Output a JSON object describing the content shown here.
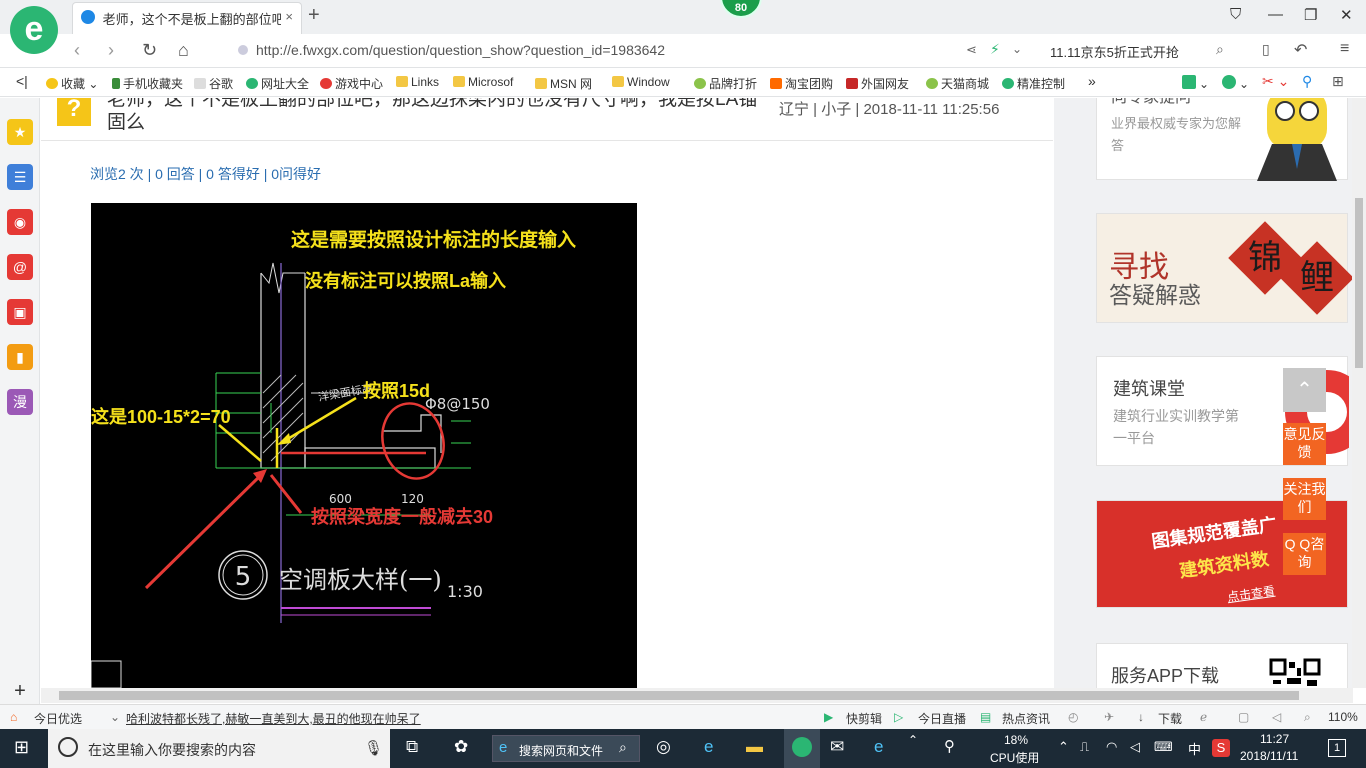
{
  "browser": {
    "tab_title": "老师，这个不是板上翻的部位吧。",
    "tab_close": "×",
    "new_tab": "+",
    "badge": "80",
    "url": "http://e.fwxgx.com/question/question_show?question_id=1983642",
    "promo": "11.11京东5折正式开抢",
    "bookmarks": [
      "收藏",
      "手机收藏夹",
      "谷歌",
      "网址大全",
      "游戏中心",
      "Links",
      "Microsof",
      "MSN 网",
      "Window",
      "品牌打折",
      "淘宝团购",
      "外国网友",
      "天猫商城",
      "精准控制"
    ],
    "bookmark_more": "»"
  },
  "question": {
    "title": "老师，这个不是板上翻的部位吧，那这边抹梁内的也没有尺寸啊，我是按LA锚固么",
    "meta": "辽宁 | 小子 | 2018-11-11 11:25:56",
    "stats": "浏览2 次 | 0 回答 | 0 答得好 | 0问得好"
  },
  "drawing": {
    "annotations": {
      "design_length": "这是需要按照设计标注的长度输入",
      "la_input": "没有标注可以按照La输入",
      "by_15d": "按照15d",
      "calc": "这是100-15*2=70",
      "beam_width": "按照梁宽度一般减去30"
    },
    "cad_labels": {
      "rebar": "Φ8@150",
      "beam": "洋梁面标高",
      "dim_600": "600",
      "dim_120": "120",
      "circle_no": "5",
      "detail_title": "空调板大样(一)",
      "scale": "1:30"
    }
  },
  "sidebar_right": {
    "expert_title": "向专家提问",
    "expert_sub": "业界最权威专家为您解答",
    "jl_title": "寻找",
    "jl_sub": "答疑解惑",
    "jl_stamp1": "锦",
    "jl_stamp2": "鲤",
    "course_title": "建筑课堂",
    "course_sub": "建筑行业实训教学第一平台",
    "tj_title": "图集规范覆盖广",
    "tj_sub": "建筑资料数",
    "tj_btn": "点击查看",
    "app_title": "服务APP下载",
    "float_feedback": "意见反馈",
    "float_follow": "关注我们",
    "float_qq": "Q Q咨询"
  },
  "statusbar": {
    "today": "今日优选",
    "news": "哈利波特都长残了,赫敏一直美到大,最丑的他现在帅呆了",
    "kuaijian": "快剪辑",
    "live": "今日直播",
    "hot": "热点资讯",
    "download": "下载",
    "zoom": "110%"
  },
  "taskbar": {
    "search_placeholder": "在这里输入你要搜索的内容",
    "browser_search": "搜索网页和文件",
    "cpu_pct": "18%",
    "cpu_label": "CPU使用",
    "ime": "中",
    "time": "11:27",
    "date": "2018/11/11",
    "notif_count": "1"
  }
}
